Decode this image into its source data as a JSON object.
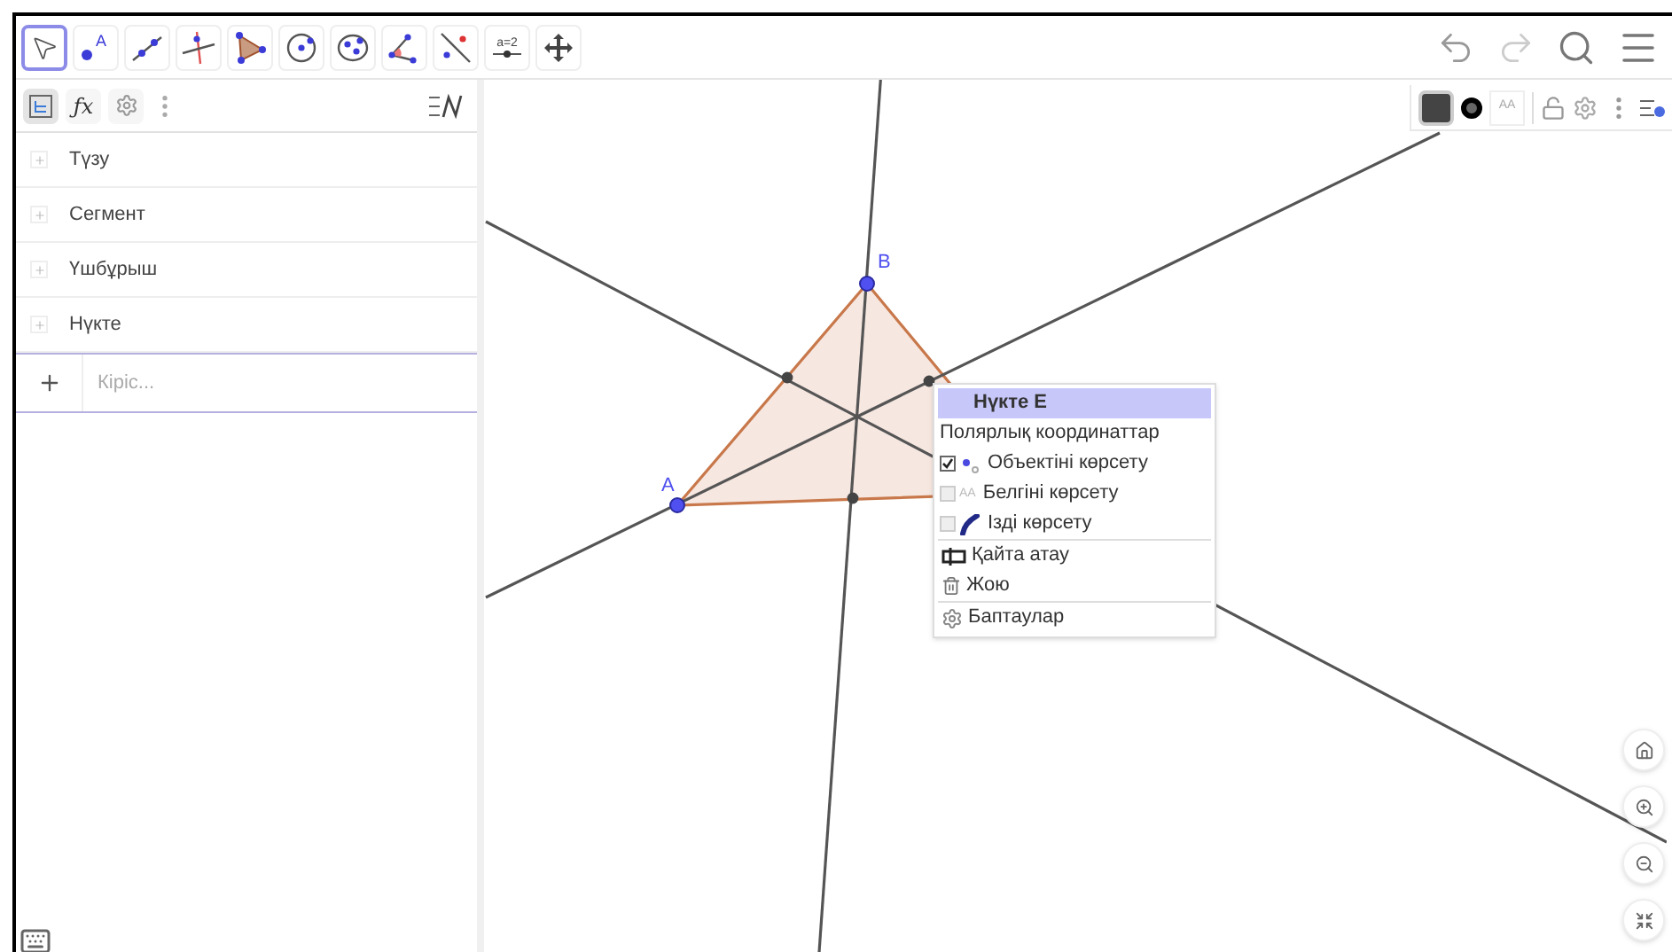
{
  "toolbar": {
    "tools": [
      {
        "kind": "move",
        "selected": true
      },
      {
        "kind": "point",
        "label": "A",
        "selected": false
      },
      {
        "kind": "line",
        "selected": false
      },
      {
        "kind": "perpendicular",
        "selected": false
      },
      {
        "kind": "polygon",
        "selected": false
      },
      {
        "kind": "circle",
        "selected": false
      },
      {
        "kind": "conic",
        "selected": false
      },
      {
        "kind": "angle",
        "selected": false
      },
      {
        "kind": "reflect",
        "selected": false
      },
      {
        "kind": "slider",
        "label": "a=2",
        "selected": false
      },
      {
        "kind": "pan",
        "selected": false
      }
    ]
  },
  "algebra": {
    "tabs": [
      {
        "kind": "algebra",
        "selected": true
      },
      {
        "kind": "tools",
        "label": "ƒx",
        "selected": false
      },
      {
        "kind": "settings",
        "selected": false
      }
    ],
    "groups": [
      {
        "label": "Түзу",
        "expanded": false
      },
      {
        "label": "Сегмент",
        "expanded": false
      },
      {
        "label": "Үшбұрыш",
        "expanded": false
      },
      {
        "label": "Нүкте",
        "expanded": false
      }
    ],
    "input": {
      "placeholder": "Кіріс..."
    }
  },
  "style_bar": {
    "label_style": "AA",
    "locked": false
  },
  "canvas": {
    "points": [
      {
        "label": "A"
      },
      {
        "label": "B"
      }
    ]
  },
  "context_menu": {
    "title": "Нүкте E",
    "items": [
      {
        "kind": "text",
        "label": "Полярлық координаттар"
      },
      {
        "kind": "check",
        "label": "Объектіні көрсету",
        "checked": true
      },
      {
        "kind": "check",
        "icon_text": "AA",
        "label": "Белгіні көрсету",
        "checked": false
      },
      {
        "kind": "check",
        "label": "Ізді көрсету",
        "checked": false
      },
      {
        "kind": "action",
        "label": "Қайта атау",
        "separator": true
      },
      {
        "kind": "action",
        "label": "Жою",
        "separator": false
      },
      {
        "kind": "action",
        "label": "Баптаулар",
        "separator": true
      }
    ]
  }
}
